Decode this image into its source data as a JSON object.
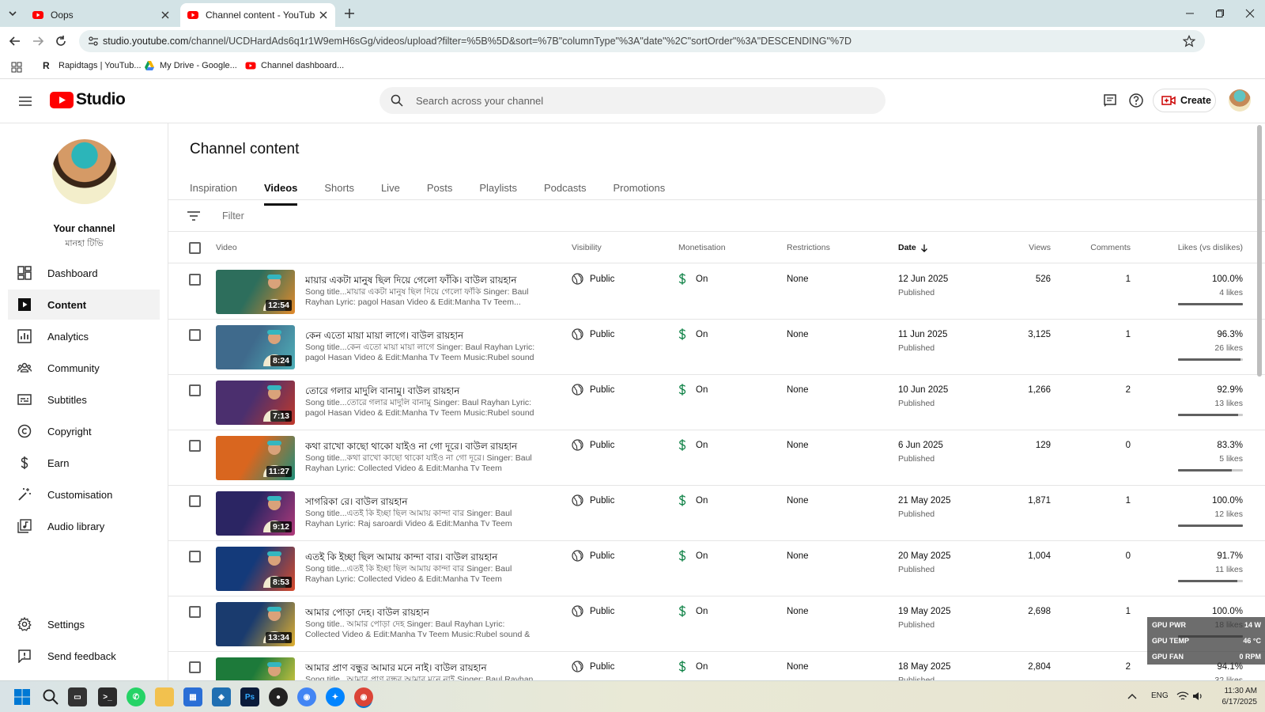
{
  "browser": {
    "tabs": [
      {
        "title": "Oops",
        "active": false
      },
      {
        "title": "Channel content - YouTube Studio",
        "active": true
      }
    ],
    "url_host": "studio.youtube.com",
    "url_rest": "/channel/UCDHardAds6q1r1W9emH6sGg/videos/upload?filter=%5B%5D&sort=%7B\"columnType\"%3A\"date\"%2C\"sortOrder\"%3A\"DESCENDING\"%7D",
    "bookmarks": [
      "Rapidtags | YouTub...",
      "My Drive - Google...",
      "Channel dashboard..."
    ]
  },
  "header": {
    "logo_text": "Studio",
    "search_placeholder": "Search across your channel",
    "create_label": "Create"
  },
  "sidebar": {
    "your_channel": "Your channel",
    "channel_name": "মানহা টিভি",
    "items": [
      {
        "label": "Dashboard",
        "icon": "dashboard-icon"
      },
      {
        "label": "Content",
        "icon": "content-icon",
        "active": true
      },
      {
        "label": "Analytics",
        "icon": "analytics-icon"
      },
      {
        "label": "Community",
        "icon": "community-icon"
      },
      {
        "label": "Subtitles",
        "icon": "subtitles-icon"
      },
      {
        "label": "Copyright",
        "icon": "copyright-icon"
      },
      {
        "label": "Earn",
        "icon": "dollar-icon"
      },
      {
        "label": "Customisation",
        "icon": "wand-icon"
      },
      {
        "label": "Audio library",
        "icon": "audio-library-icon"
      }
    ],
    "bottom": [
      {
        "label": "Settings",
        "icon": "gear-icon"
      },
      {
        "label": "Send feedback",
        "icon": "feedback-icon"
      }
    ]
  },
  "main": {
    "title": "Channel content",
    "tabs": [
      "Inspiration",
      "Videos",
      "Shorts",
      "Live",
      "Posts",
      "Playlists",
      "Podcasts",
      "Promotions"
    ],
    "active_tab": "Videos",
    "filter_placeholder": "Filter",
    "columns": {
      "video": "Video",
      "visibility": "Visibility",
      "monetisation": "Monetisation",
      "restrictions": "Restrictions",
      "date": "Date",
      "views": "Views",
      "comments": "Comments",
      "likes": "Likes (vs dislikes)"
    },
    "rows": [
      {
        "title": "মায়ার একটা মানুষ ছিল দিয়ে গেলো ফাঁকি। বাউল রায়হান",
        "desc": "Song title...মায়ার একটা মানুষ ছিল দিয়ে গেলো ফাঁকি Singer: Baul Rayhan Lyric: pagol Hasan Video & Edit:Manha Tv Teem...",
        "duration": "12:54",
        "visibility": "Public",
        "monetisation": "On",
        "restrictions": "None",
        "date": "12 Jun 2025",
        "status": "Published",
        "views": "526",
        "comments": "1",
        "likes_pct": "100.0%",
        "likes_count": "4 likes",
        "like_ratio": 1.0,
        "thumb_colors": [
          "#2d6e5c",
          "#e38a2b"
        ]
      },
      {
        "title": "কেন এতো মায়া মায়া লাগে। বাউল রায়হান",
        "desc": "Song title...কেন এতো মায়া মায়া লাগে Singer: Baul Rayhan Lyric: pagol Hasan Video & Edit:Manha Tv Teem Music:Rubel sound &...",
        "duration": "8:24",
        "visibility": "Public",
        "monetisation": "On",
        "restrictions": "None",
        "date": "11 Jun 2025",
        "status": "Published",
        "views": "3,125",
        "comments": "1",
        "likes_pct": "96.3%",
        "likes_count": "26 likes",
        "like_ratio": 0.963,
        "thumb_colors": [
          "#3f6a8c",
          "#4fb0b8"
        ]
      },
      {
        "title": "তোরে গলার মাদুলি বানামু। বাউল রায়হান",
        "desc": "Song title...তোরে গলার মাদুলি বানামু Singer: Baul Rayhan Lyric: pagol Hasan Video & Edit:Manha Tv Teem Music:Rubel sound &...",
        "duration": "7:13",
        "visibility": "Public",
        "monetisation": "On",
        "restrictions": "None",
        "date": "10 Jun 2025",
        "status": "Published",
        "views": "1,266",
        "comments": "2",
        "likes_pct": "92.9%",
        "likes_count": "13 likes",
        "like_ratio": 0.929,
        "thumb_colors": [
          "#4b2f6e",
          "#c0392b"
        ]
      },
      {
        "title": "কথা রাখো কাছো থাকো যাইও না গো দূরে। বাউল রায়হান",
        "desc": "Song title...কথা রাখো কাছো থাকো যাইও না গো দূরে। Singer: Baul Rayhan Lyric: Collected Video & Edit:Manha Tv Teem Music:Rube...",
        "duration": "11:27",
        "visibility": "Public",
        "monetisation": "On",
        "restrictions": "None",
        "date": "6 Jun 2025",
        "status": "Published",
        "views": "129",
        "comments": "0",
        "likes_pct": "83.3%",
        "likes_count": "5 likes",
        "like_ratio": 0.833,
        "thumb_colors": [
          "#d9661f",
          "#1e8f7a"
        ]
      },
      {
        "title": "সাগরিকা রে। বাউল রায়হান",
        "desc": "Song title...এতই কি ইচ্ছা ছিল আমায় কান্দা বার Singer: Baul Rayhan Lyric: Raj saroardi Video & Edit:Manha Tv Teem Music:Rubel sou...",
        "duration": "9:12",
        "visibility": "Public",
        "monetisation": "On",
        "restrictions": "None",
        "date": "21 May 2025",
        "status": "Published",
        "views": "1,871",
        "comments": "1",
        "likes_pct": "100.0%",
        "likes_count": "12 likes",
        "like_ratio": 1.0,
        "thumb_colors": [
          "#2b2563",
          "#b03a7a"
        ]
      },
      {
        "title": "এতই কি ইচ্ছা ছিল আমায় কান্দা বার। বাউল রায়হান",
        "desc": "Song title...এতই কি ইচ্ছা ছিল আমায় কান্দা বার Singer: Baul Rayhan Lyric: Collected Video & Edit:Manha Tv Teem Music:Rubel sound ...",
        "duration": "8:53",
        "visibility": "Public",
        "monetisation": "On",
        "restrictions": "None",
        "date": "20 May 2025",
        "status": "Published",
        "views": "1,004",
        "comments": "0",
        "likes_pct": "91.7%",
        "likes_count": "11 likes",
        "like_ratio": 0.917,
        "thumb_colors": [
          "#143a7a",
          "#d94a2b"
        ]
      },
      {
        "title": "আমার পোড়া দেহ। বাউল রায়হান",
        "desc": "Song title.. আমার পোড়া দেহ Singer: Baul Rayhan Lyric: Collected Video & Edit:Manha Tv Teem Music:Rubel sound & recording Lev...",
        "duration": "13:34",
        "visibility": "Public",
        "monetisation": "On",
        "restrictions": "None",
        "date": "19 May 2025",
        "status": "Published",
        "views": "2,698",
        "comments": "1",
        "likes_pct": "100.0%",
        "likes_count": "18 likes",
        "like_ratio": 1.0,
        "thumb_colors": [
          "#1a3b6e",
          "#e0b030"
        ]
      },
      {
        "title": "আমার প্রাণ বন্ধুর আমার মনে নাই। বাউল রায়হান",
        "desc": "Song title...আমার প্রাণ বন্ধুর আমার মনে নাই Singer: Baul Rayhan",
        "duration": "",
        "visibility": "Public",
        "monetisation": "On",
        "restrictions": "None",
        "date": "18 May 2025",
        "status": "Published",
        "views": "2,804",
        "comments": "2",
        "likes_pct": "94.1%",
        "likes_count": "32 likes",
        "like_ratio": 0.941,
        "thumb_colors": [
          "#1d7a3a",
          "#e8d040"
        ]
      }
    ]
  },
  "gpu_overlay": [
    {
      "label": "GPU PWR",
      "value": "14 W"
    },
    {
      "label": "GPU TEMP",
      "value": "46 °C"
    },
    {
      "label": "GPU FAN",
      "value": "0 RPM"
    }
  ],
  "taskbar": {
    "lang": "ENG",
    "time": "11:30 AM",
    "date": "6/17/2025"
  },
  "colors": {
    "yt_red": "#ff0000",
    "tab_bg": "#d3e3e6"
  }
}
